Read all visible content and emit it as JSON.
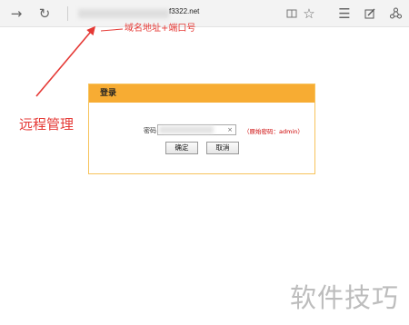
{
  "browser": {
    "url_text": "f3322.net",
    "icons": [
      "back-icon",
      "refresh-icon",
      "reading-view-icon",
      "favorite-star-icon",
      "hub-menu-icon",
      "web-note-icon",
      "share-icon"
    ]
  },
  "annotations": {
    "domain_port": "域名地址+端口号",
    "remote_admin": "远程管理",
    "color": "#e53935"
  },
  "login": {
    "title": "登录",
    "password_label": "密码",
    "clear_glyph": "×",
    "password_hint": "（原始密码：admin）",
    "confirm_label": "确定",
    "cancel_label": "取消",
    "header_color": "#f7ac33"
  },
  "watermark": "软件技巧"
}
